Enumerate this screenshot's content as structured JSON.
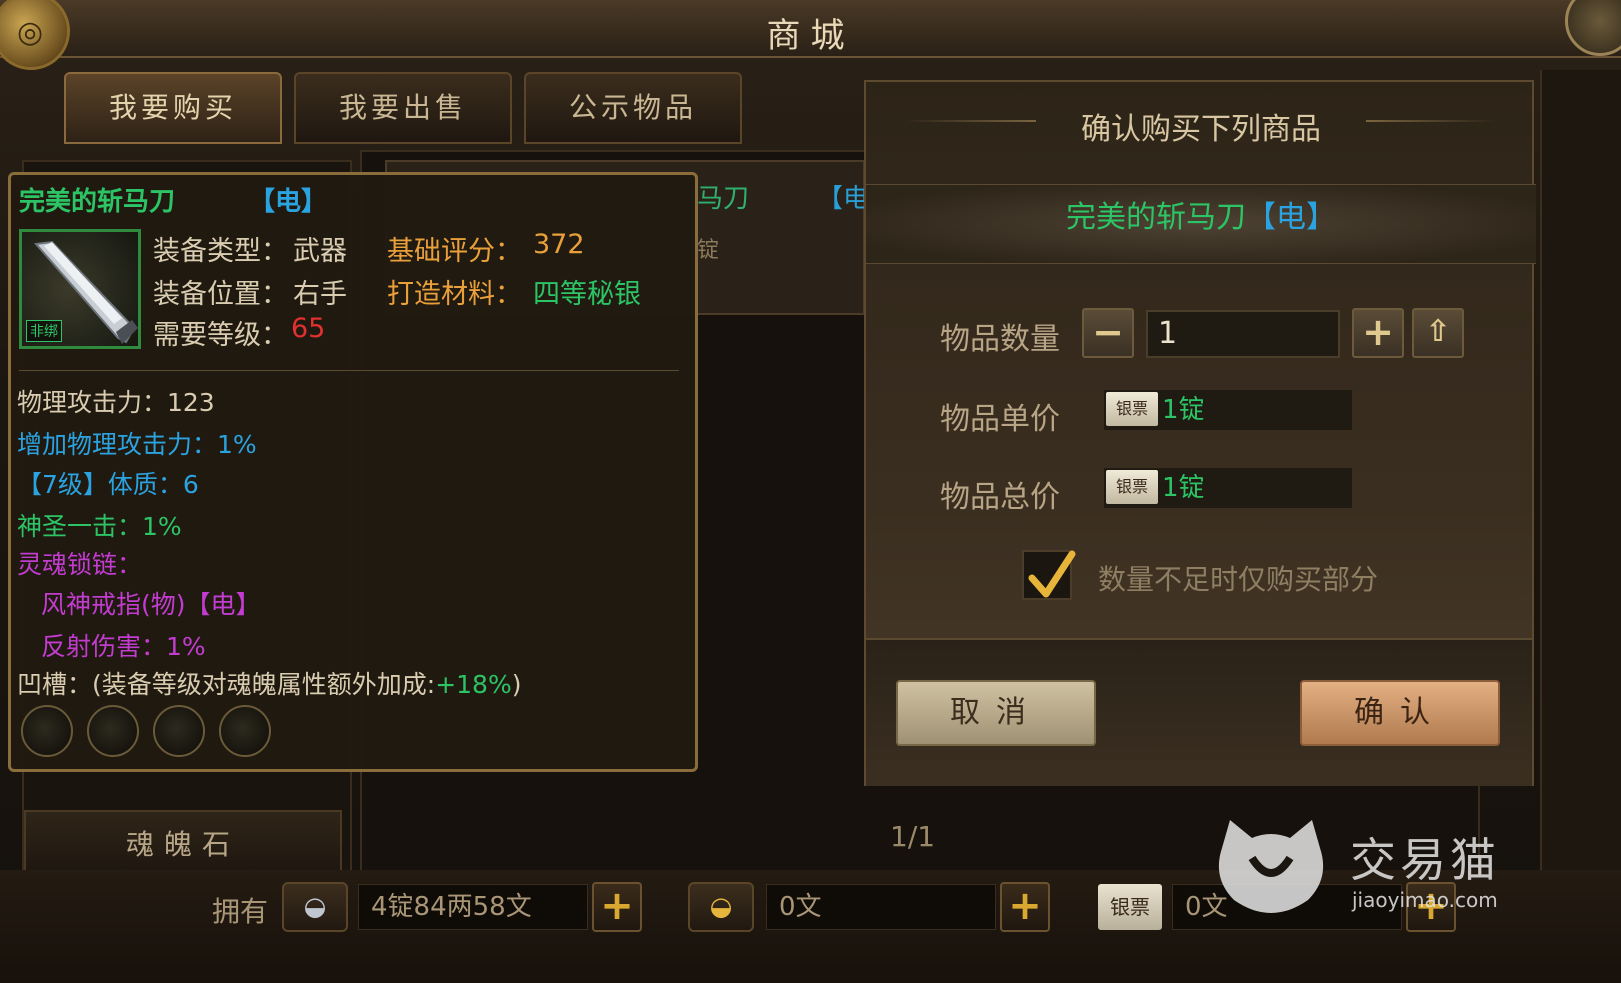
{
  "window": {
    "title": "商城"
  },
  "tabs": [
    {
      "label": "我要购买",
      "active": true
    },
    {
      "label": "我要出售",
      "active": false
    },
    {
      "label": "公示物品",
      "active": false
    }
  ],
  "categories": [
    {
      "label": "魂魄石"
    }
  ],
  "listing": {
    "name_fragment": "马刀",
    "element_fragment": "【电",
    "price_fragment": "锭"
  },
  "pagination": {
    "label": "1/1"
  },
  "tooltip": {
    "item_name": "完美的斩马刀",
    "item_element": "【电】",
    "bind_status": "非绑",
    "equip_type_label": "装备类型：",
    "equip_type_value": "武器",
    "base_score_label": "基础评分：",
    "base_score_value": "372",
    "equip_slot_label": "装备位置：",
    "equip_slot_value": "右手",
    "forge_material_label": "打造材料：",
    "forge_material_value": "四等秘银",
    "required_level_label": "需要等级：",
    "required_level_value": "65",
    "attributes": [
      {
        "text": "物理攻击力：123",
        "color": "#d9ccb0"
      },
      {
        "text": "增加物理攻击力：1%",
        "color": "#2aa3e0"
      },
      {
        "text": "【7级】体质：6",
        "color": "#2aa3e0"
      },
      {
        "text": "神圣一击：1%",
        "color": "#2cc465"
      },
      {
        "text": "灵魂锁链：",
        "color": "#c23ccf"
      },
      {
        "text": "风神戒指(物)【电】",
        "color": "#c23ccf"
      },
      {
        "text": "反射伤害：1%",
        "color": "#c23ccf"
      }
    ],
    "socket_label": "凹槽：(装备等级对魂魄属性额外加成:",
    "socket_bonus": "+18%",
    "socket_close": ")",
    "socket_count": 4
  },
  "dialog": {
    "title": "确认购买下列商品",
    "item_name": "完美的斩马刀",
    "item_element": "【电】",
    "quantity_label": "物品数量",
    "quantity_value": "1",
    "unit_price_label": "物品单价",
    "unit_price_currency": "银票",
    "unit_price_value": "1锭",
    "total_price_label": "物品总价",
    "total_price_currency": "银票",
    "total_price_value": "1锭",
    "partial_purchase_label": "数量不足时仅购买部分",
    "partial_purchase_checked": true,
    "cancel_label": "取消",
    "confirm_label": "确认"
  },
  "wallet": {
    "own_label": "拥有",
    "silver_value": "4锭84两58文",
    "gold_value": "0文",
    "note_label": "银票",
    "note_value": "0文"
  },
  "watermark": {
    "brand": "交易猫",
    "url": "jiaoyimao.com"
  },
  "colors": {
    "item_green": "#2cc465",
    "element_blue": "#2aa3e0",
    "soul_purple": "#c23ccf",
    "score_orange": "#e9a03a",
    "level_red": "#e23030"
  }
}
